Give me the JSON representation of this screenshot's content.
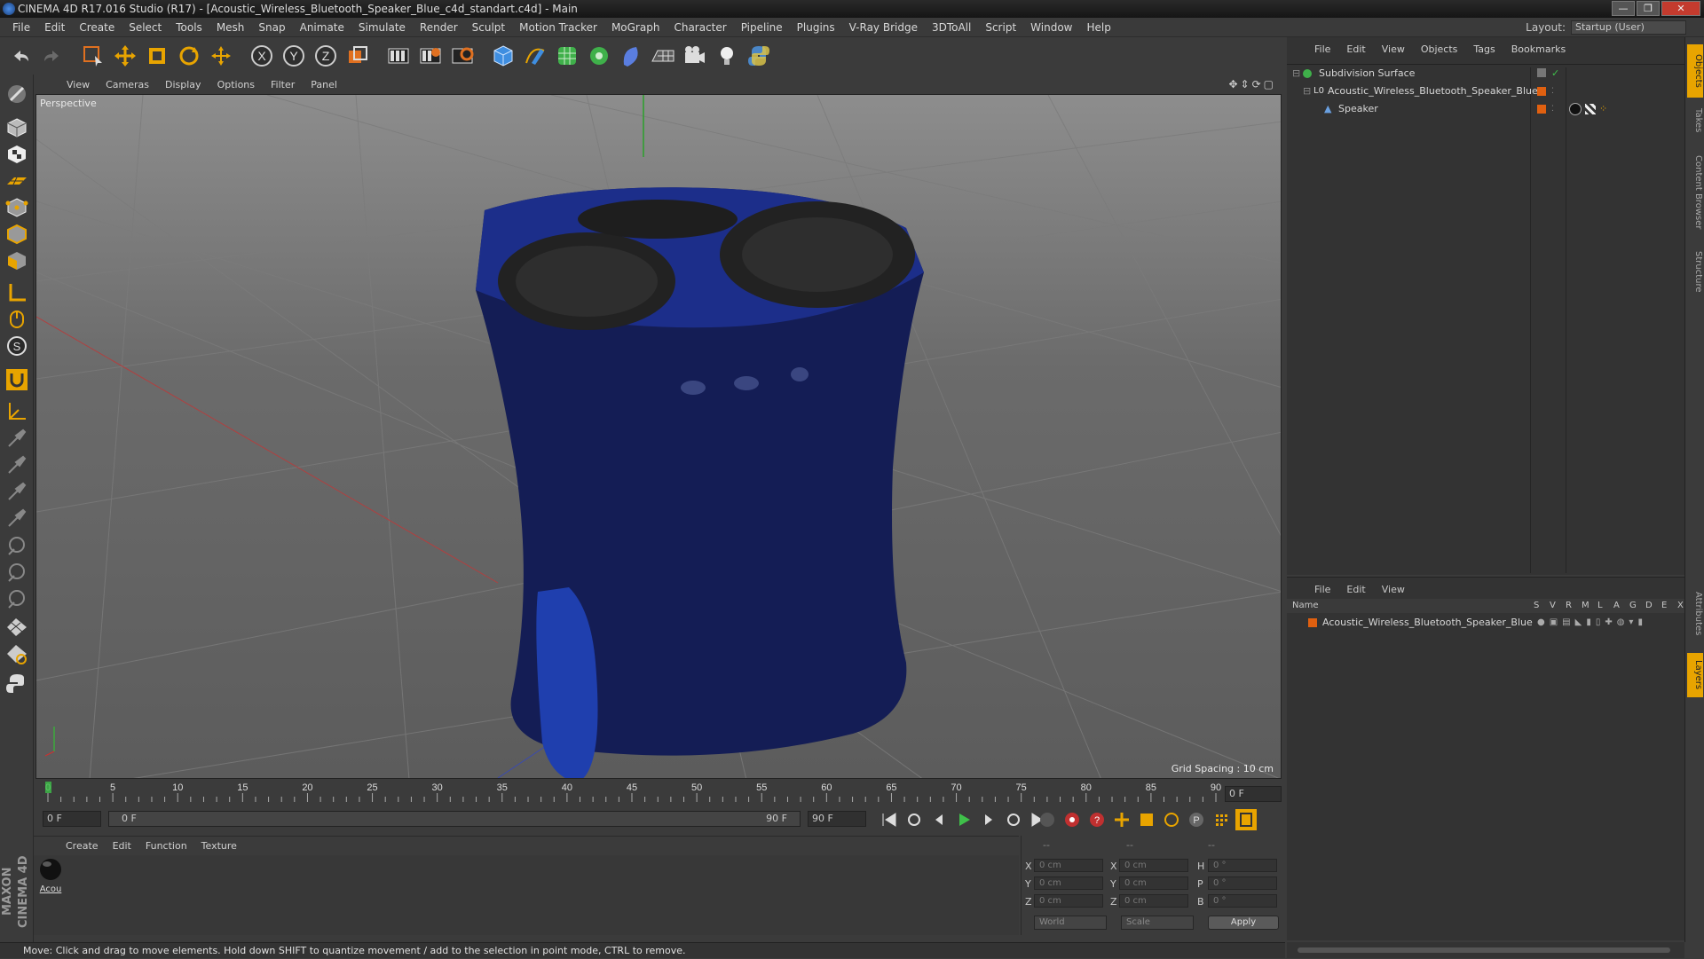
{
  "titlebar": {
    "title": "CINEMA 4D R17.016 Studio (R17) - [Acoustic_Wireless_Bluetooth_Speaker_Blue_c4d_standart.c4d] - Main",
    "min": "—",
    "max": "❐",
    "close": "✕"
  },
  "menubar": {
    "items": [
      "File",
      "Edit",
      "Create",
      "Select",
      "Tools",
      "Mesh",
      "Snap",
      "Animate",
      "Simulate",
      "Render",
      "Sculpt",
      "Motion Tracker",
      "MoGraph",
      "Character",
      "Pipeline",
      "Plugins",
      "V-Ray Bridge",
      "3DToAll",
      "Script",
      "Window",
      "Help"
    ],
    "layout_label": "Layout:",
    "layout_value": "Startup (User)"
  },
  "toolbar": {
    "icons": [
      "undo-icon",
      "redo-icon",
      "live-selection-icon",
      "move-icon",
      "scale-icon",
      "rotate-icon",
      "transform-icon",
      "x-axis-icon",
      "y-axis-icon",
      "z-axis-icon",
      "coordinate-system-icon",
      "render-view-icon",
      "render-picture-viewer-icon",
      "render-settings-icon",
      "cube-icon",
      "pen-spline-icon",
      "subdivision-icon",
      "cloner-icon",
      "deformer-icon",
      "floor-icon",
      "camera-icon",
      "light-icon",
      "python-icon"
    ],
    "axis_x": "X",
    "axis_y": "Y",
    "axis_z": "Z"
  },
  "viewport": {
    "menu": [
      "View",
      "Cameras",
      "Display",
      "Options",
      "Filter",
      "Panel"
    ],
    "label": "Perspective",
    "grid_spacing": "Grid Spacing : 10 cm"
  },
  "timeline": {
    "ticks": [
      "0",
      "5",
      "10",
      "15",
      "20",
      "25",
      "30",
      "35",
      "40",
      "45",
      "50",
      "55",
      "60",
      "65",
      "70",
      "75",
      "80",
      "85",
      "90"
    ],
    "current_frame": "0 F",
    "start_field": "0 F",
    "range_start": "0 F",
    "range_end": "90 F",
    "end_field": "90 F"
  },
  "material_panel": {
    "menu": [
      "Create",
      "Edit",
      "Function",
      "Texture"
    ],
    "material_name": "Acou"
  },
  "coordinates": {
    "header": [
      "--",
      "--",
      "--"
    ],
    "rows": [
      {
        "axis": "X",
        "pos": "0 cm",
        "axis2": "X",
        "size": "0 cm",
        "axis3": "H",
        "rot": "0 °"
      },
      {
        "axis": "Y",
        "pos": "0 cm",
        "axis2": "Y",
        "size": "0 cm",
        "axis3": "P",
        "rot": "0 °"
      },
      {
        "axis": "Z",
        "pos": "0 cm",
        "axis2": "Z",
        "size": "0 cm",
        "axis3": "B",
        "rot": "0 °"
      }
    ],
    "space": "World",
    "mode": "Scale",
    "apply": "Apply"
  },
  "status": {
    "text": "Move: Click and drag to move elements. Hold down SHIFT to quantize movement / add to the selection in point mode, CTRL to remove."
  },
  "object_manager": {
    "menu": [
      "File",
      "Edit",
      "View",
      "Objects",
      "Tags",
      "Bookmarks"
    ],
    "objects": [
      {
        "name": "Subdivision Surface",
        "indent": 0
      },
      {
        "name": "Acoustic_Wireless_Bluetooth_Speaker_Blue",
        "indent": 1
      },
      {
        "name": "Speaker",
        "indent": 2
      }
    ]
  },
  "layer_manager": {
    "menu": [
      "File",
      "Edit",
      "View"
    ],
    "header_name": "Name",
    "header_cols": [
      "S",
      "V",
      "R",
      "M",
      "L",
      "A",
      "G",
      "D",
      "E",
      "X"
    ],
    "layers": [
      {
        "name": "Acoustic_Wireless_Bluetooth_Speaker_Blue"
      }
    ]
  },
  "right_tabs": [
    "Objects",
    "Takes",
    "Content Browser",
    "Structure",
    "Attributes",
    "Layers"
  ],
  "colors": {
    "accent": "#f0a000",
    "speaker_body": "#1a2a6e",
    "layer_color": "#e06010"
  },
  "maxon": "MAXON CINEMA 4D"
}
